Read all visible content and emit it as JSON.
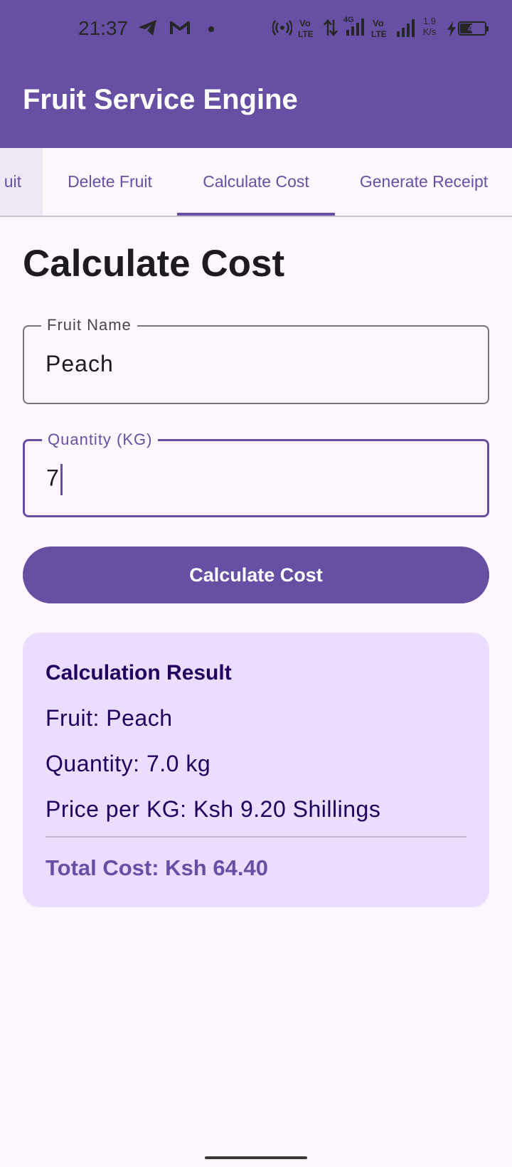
{
  "status_bar": {
    "time": "21:37",
    "icons": [
      "telegram-icon",
      "gmail-icon",
      "notification-dot-icon",
      "hotspot-icon",
      "volte-icon",
      "data-arrows-icon",
      "signal-4g-icon",
      "volte-icon",
      "signal-icon",
      "network-speed-icon",
      "charging-icon",
      "battery-icon"
    ],
    "net_speed_value": "1.9",
    "net_speed_unit": "K/s",
    "lte_label": "Vo\nLTE",
    "network_type": "4G",
    "battery_level": "47"
  },
  "app_bar": {
    "title": "Fruit Service Engine"
  },
  "tabs": [
    {
      "label": "uit",
      "selected": false
    },
    {
      "label": "Delete Fruit",
      "selected": false
    },
    {
      "label": "Calculate Cost",
      "selected": true
    },
    {
      "label": "Generate Receipt",
      "selected": false
    }
  ],
  "page": {
    "title": "Calculate Cost"
  },
  "form": {
    "fruit_name": {
      "label": "Fruit Name",
      "value": "Peach"
    },
    "quantity": {
      "label": "Quantity (KG)",
      "value": "7"
    },
    "submit_label": "Calculate Cost"
  },
  "result": {
    "title": "Calculation Result",
    "fruit": "Fruit: Peach",
    "quantity": "Quantity: 7.0 kg",
    "price_per_kg": "Price per KG: Ksh 9.20 Shillings",
    "total": "Total Cost: Ksh 64.40"
  },
  "colors": {
    "primary": "#6750a4",
    "card_background": "#eaddff",
    "card_text": "#21005d",
    "background": "#fdf7fd"
  }
}
